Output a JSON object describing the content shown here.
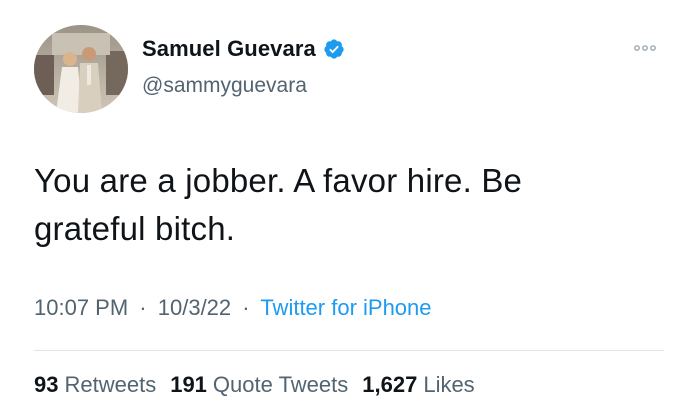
{
  "user": {
    "display_name": "Samuel Guevara",
    "handle": "@sammyguevara",
    "verified_icon": "verified-badge-icon",
    "avatar_icon": "profile-photo"
  },
  "tweet": {
    "text": "You are a jobber. A favor hire. Be grateful bitch.",
    "time": "10:07 PM",
    "date": "10/3/22",
    "separator": "·",
    "source": "Twitter for iPhone"
  },
  "stats": {
    "retweets_count": "93",
    "retweets_label": "Retweets",
    "quote_tweets_count": "191",
    "quote_tweets_label": "Quote Tweets",
    "likes_count": "1,627",
    "likes_label": "Likes"
  },
  "colors": {
    "accent": "#1d9bf0",
    "secondary_text": "#536471",
    "primary_text": "#0f1419",
    "divider": "#dfe5ea"
  }
}
